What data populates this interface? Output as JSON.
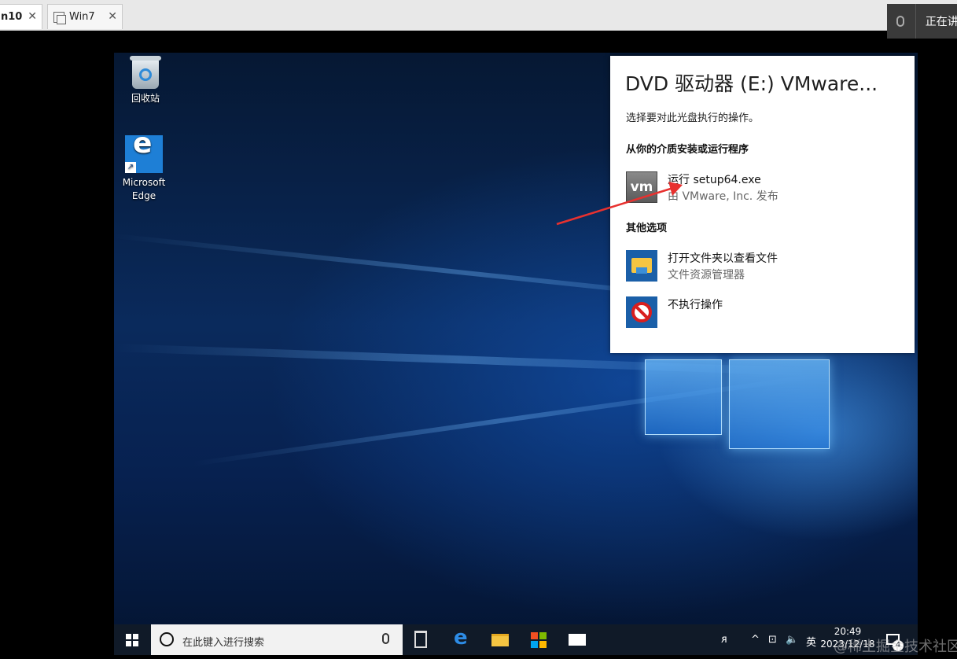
{
  "host": {
    "tabs": [
      {
        "label": "n10",
        "active": true
      },
      {
        "label": "Win7",
        "active": false
      }
    ],
    "tab_close_glyph": "✕",
    "voice_status": "正在讲"
  },
  "desktop": {
    "icons": [
      {
        "label": "回收站",
        "icon": "recycle-bin-icon"
      },
      {
        "label": "Microsoft Edge",
        "icon": "edge-icon"
      }
    ]
  },
  "autoplay": {
    "title": "DVD 驱动器 (E:) VMware...",
    "subtitle": "选择要对此光盘执行的操作。",
    "section_install": "从你的介质安装或运行程序",
    "section_other": "其他选项",
    "options": [
      {
        "main": "运行 setup64.exe",
        "sub": "由 VMware, Inc. 发布",
        "icon": "vmware-icon",
        "icon_text": "vm"
      },
      {
        "main": "打开文件夹以查看文件",
        "sub": "文件资源管理器",
        "icon": "folder-icon"
      },
      {
        "main": "不执行操作",
        "sub": "",
        "icon": "no-action-icon"
      }
    ],
    "annotation_color": "#e8312f"
  },
  "taskbar": {
    "search_placeholder": "在此键入进行搜索",
    "edge_glyph": "e",
    "tray": {
      "people_glyph": "ᴙ",
      "chevron": "^",
      "network": "⊡",
      "volume": "🔈",
      "ime": "英"
    },
    "time": "20:49",
    "date": "2023/12/18",
    "notification_count": "4"
  },
  "watermark": "@稀土掘金技术社区",
  "colors": {
    "desktop_dark": "#061833",
    "desktop_light": "#1e7fd6",
    "taskbar": "#101a28",
    "accent": "#1e7fd6"
  }
}
